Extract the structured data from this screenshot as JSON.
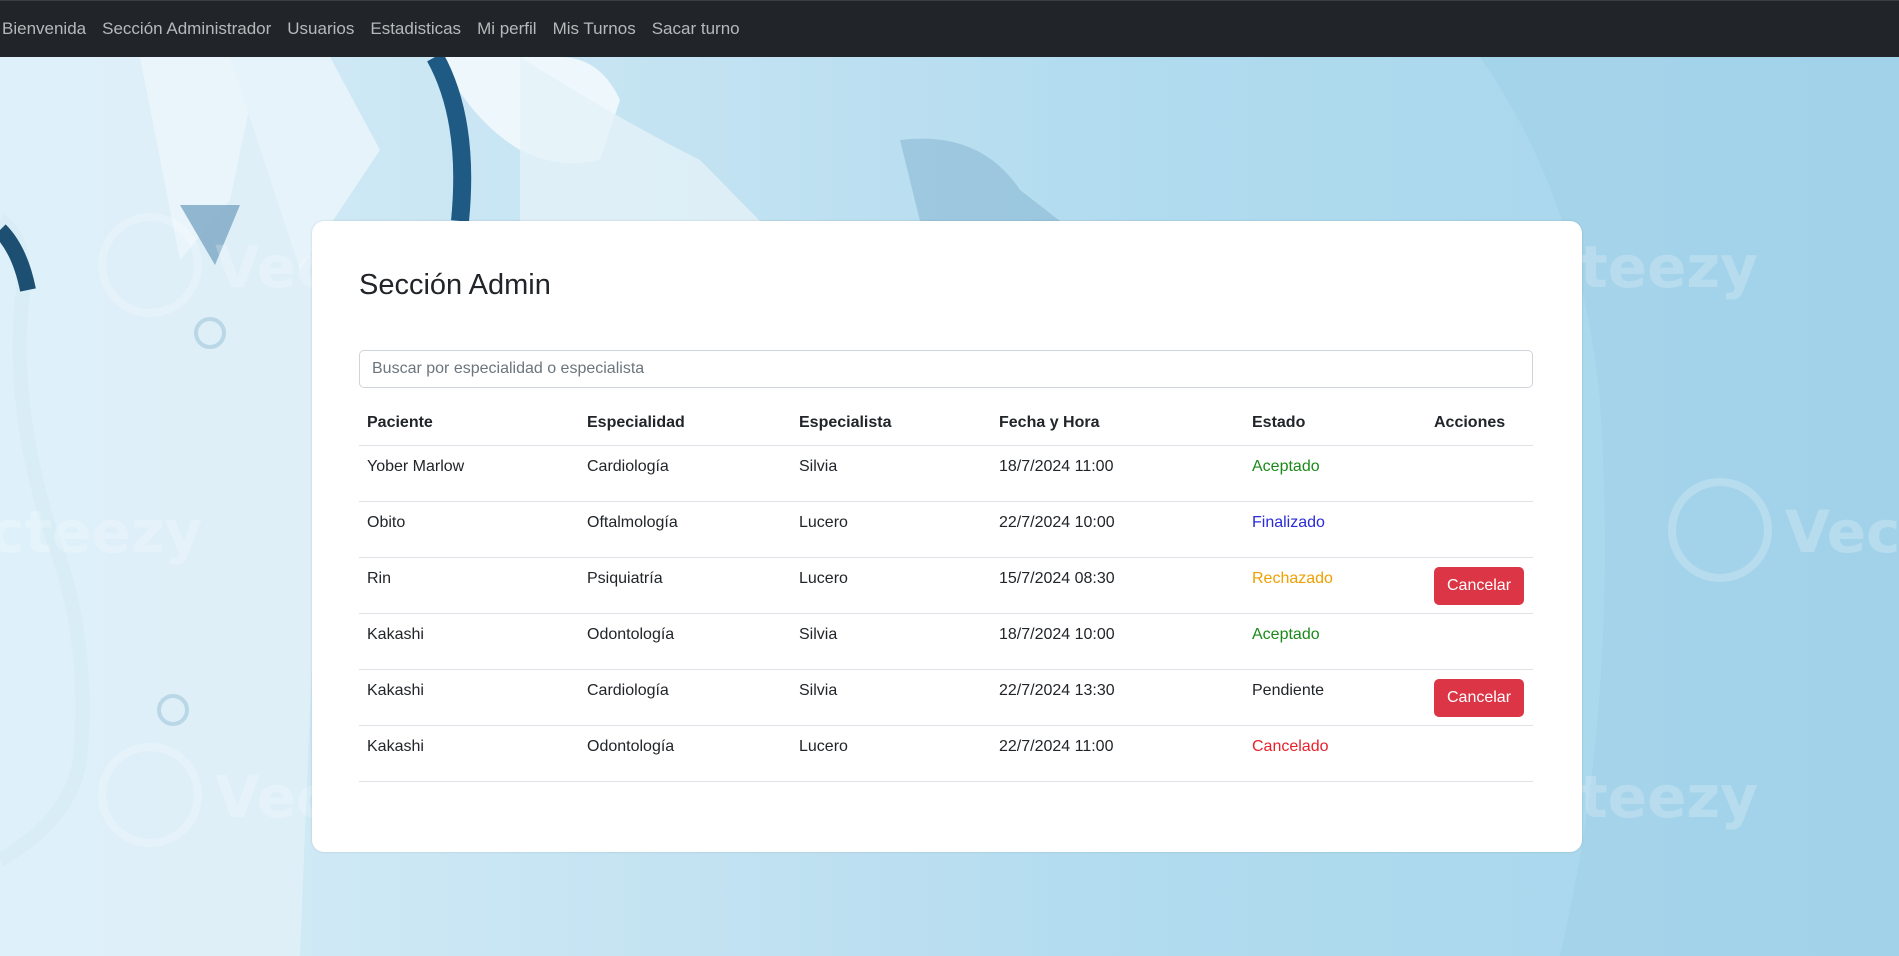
{
  "navbar": {
    "links": [
      "Bienvenida",
      "Sección Administrador",
      "Usuarios",
      "Estadisticas",
      "Mi perfil",
      "Mis Turnos",
      "Sacar turno"
    ]
  },
  "background": {
    "watermark_text": "Vecteezy"
  },
  "card": {
    "title": "Sección Admin",
    "search": {
      "placeholder": "Buscar por especialidad o especialista",
      "value": ""
    },
    "table": {
      "headers": [
        "Paciente",
        "Especialidad",
        "Especialista",
        "Fecha y Hora",
        "Estado",
        "Acciones"
      ],
      "rows": [
        {
          "paciente": "Yober Marlow",
          "especialidad": "Cardiología",
          "especialista": "Silvia",
          "fecha": "18/7/2024 11:00",
          "estado": "Aceptado",
          "accion": ""
        },
        {
          "paciente": "Obito",
          "especialidad": "Oftalmología",
          "especialista": "Lucero",
          "fecha": "22/7/2024 10:00",
          "estado": "Finalizado",
          "accion": ""
        },
        {
          "paciente": "Rin",
          "especialidad": "Psiquiatría",
          "especialista": "Lucero",
          "fecha": "15/7/2024 08:30",
          "estado": "Rechazado",
          "accion": "Cancelar"
        },
        {
          "paciente": "Kakashi",
          "especialidad": "Odontología",
          "especialista": "Silvia",
          "fecha": "18/7/2024 10:00",
          "estado": "Aceptado",
          "accion": ""
        },
        {
          "paciente": "Kakashi",
          "especialidad": "Cardiología",
          "especialista": "Silvia",
          "fecha": "22/7/2024 13:30",
          "estado": "Pendiente",
          "accion": "Cancelar"
        },
        {
          "paciente": "Kakashi",
          "especialidad": "Odontología",
          "especialista": "Lucero",
          "fecha": "22/7/2024 11:00",
          "estado": "Cancelado",
          "accion": ""
        }
      ]
    }
  },
  "colors": {
    "navbar_bg": "#212529",
    "status_aceptado": "#1a8a1a",
    "status_finalizado": "#2a2ad6",
    "status_rechazado": "#f0a000",
    "status_pendiente": "#212529",
    "status_cancelado": "#e8202a",
    "danger_button": "#dc3545"
  }
}
